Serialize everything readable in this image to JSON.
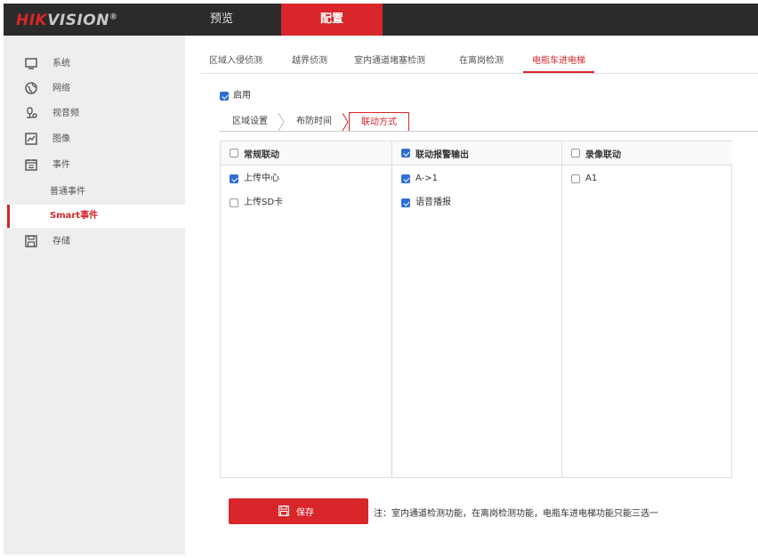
{
  "header": {
    "logo_text": "HIKVISION",
    "logo_reg": "®",
    "nav": [
      {
        "label": "预览"
      },
      {
        "label": "配置"
      }
    ]
  },
  "sidebar": {
    "items": [
      {
        "label": "系统",
        "icon": "monitor-icon"
      },
      {
        "label": "网络",
        "icon": "globe-icon"
      },
      {
        "label": "视音频",
        "icon": "camera-mic-icon"
      },
      {
        "label": "图像",
        "icon": "image-icon"
      },
      {
        "label": "事件",
        "icon": "calendar-icon"
      },
      {
        "label": "普通事件"
      },
      {
        "label": "Smart事件"
      },
      {
        "label": "存储",
        "icon": "storage-icon"
      }
    ]
  },
  "tabs": [
    {
      "label": "区域入侵侦测"
    },
    {
      "label": "越界侦测"
    },
    {
      "label": "室内通道堵塞检测"
    },
    {
      "label": "在离岗检测"
    },
    {
      "label": "电瓶车进电梯"
    }
  ],
  "enable": {
    "label": "启用",
    "checked": true
  },
  "steps": [
    {
      "label": "区域设置"
    },
    {
      "label": "布防时间"
    },
    {
      "label": "联动方式"
    }
  ],
  "linkage": {
    "columns": [
      {
        "header": "常规联动",
        "checked": false,
        "rows": [
          {
            "label": "上传中心",
            "checked": true
          },
          {
            "label": "上传SD卡",
            "checked": false
          }
        ]
      },
      {
        "header": "联动报警输出",
        "checked": true,
        "rows": [
          {
            "label": "A->1",
            "checked": true
          },
          {
            "label": "语音播报",
            "checked": true
          }
        ]
      },
      {
        "header": "录像联动",
        "checked": false,
        "rows": [
          {
            "label": "A1",
            "checked": false
          }
        ]
      }
    ]
  },
  "save": {
    "label": "保存",
    "icon": "save-icon"
  },
  "note": "注：室内通道检测功能，在离岗检测功能，电瓶车进电梯功能只能三选一",
  "colors": {
    "accent": "#d8262a",
    "header_bg": "#2b2b2b",
    "sidebar_bg": "#eeeeee",
    "checkbox": "#2d6fd6"
  }
}
